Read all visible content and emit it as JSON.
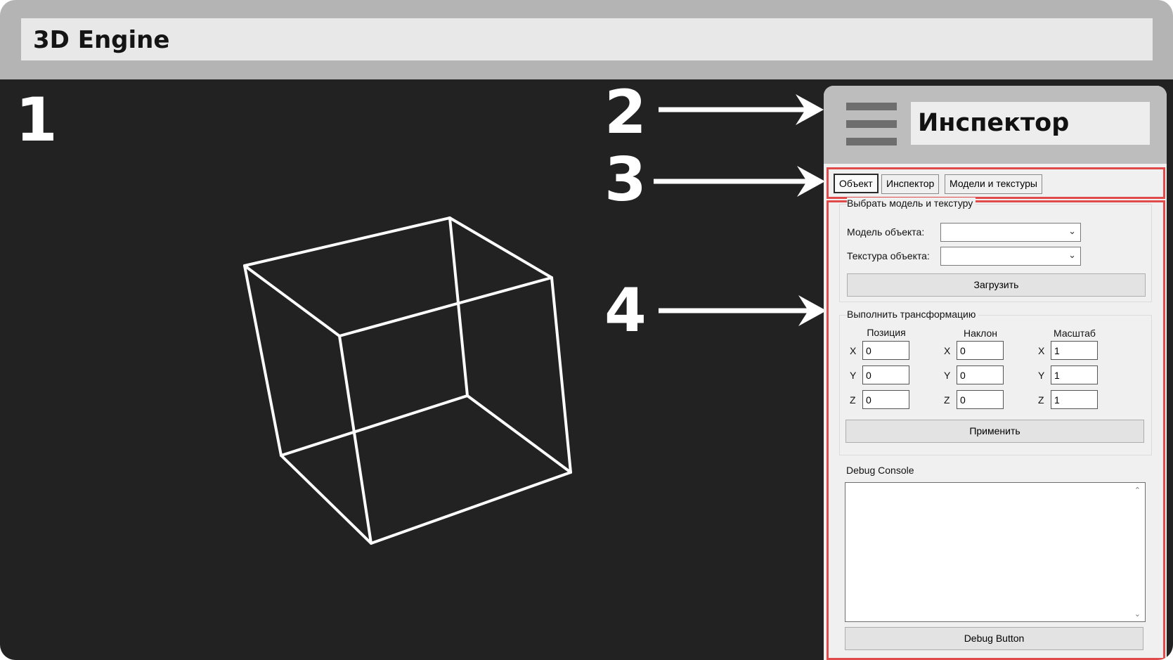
{
  "app": {
    "title": "3D Engine"
  },
  "callouts": [
    "1",
    "2",
    "3",
    "4"
  ],
  "inspector": {
    "title": "Инспектор",
    "tabs": [
      {
        "label": "Объект",
        "active": true
      },
      {
        "label": "Инспектор",
        "active": false
      },
      {
        "label": "Модели и текстуры",
        "active": false
      }
    ],
    "model_group": {
      "title": "Выбрать модель и текстуру",
      "model_label": "Модель объекта:",
      "model_value": "",
      "texture_label": "Текстура объекта:",
      "texture_value": "",
      "load_button": "Загрузить"
    },
    "transform_group": {
      "title": "Выполнить трансформацию",
      "columns": [
        "Позиция",
        "Наклон",
        "Масштаб"
      ],
      "axes": [
        "X",
        "Y",
        "Z"
      ],
      "position": [
        "0",
        "0",
        "0"
      ],
      "rotation": [
        "0",
        "0",
        "0"
      ],
      "scale": [
        "1",
        "1",
        "1"
      ],
      "apply_button": "Применить"
    },
    "debug": {
      "title": "Debug Console",
      "content": "",
      "button": "Debug Button"
    }
  },
  "colors": {
    "viewport": "#222222",
    "cube": "#ffffff",
    "highlight": "#e04a4a",
    "frame": "#b4b4b4"
  },
  "icons": {
    "menu": "hamburger-icon",
    "combo_chevron": "chevron-down-icon",
    "scroll_up": "scroll-up-icon",
    "scroll_down": "scroll-down-icon"
  }
}
